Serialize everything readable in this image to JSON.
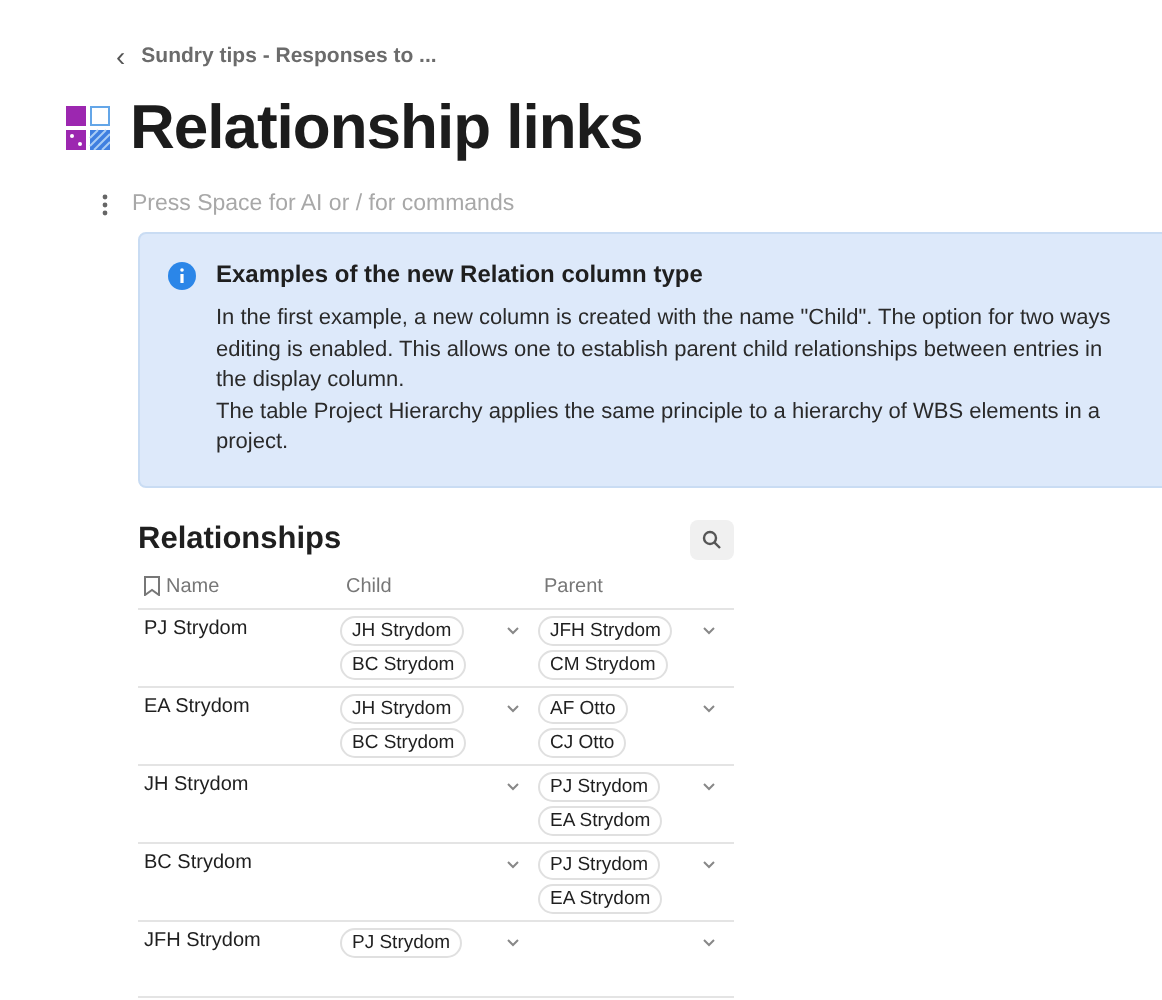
{
  "breadcrumb": {
    "back": "‹",
    "label": "Sundry tips - Responses to ..."
  },
  "page": {
    "title": "Relationship links",
    "placeholder": "Press Space for AI or / for commands"
  },
  "callout": {
    "title": "Examples of the new Relation column type",
    "paragraphs": [
      "In the first example, a new column is created with the name \"Child\". The option for two ways editing is enabled. This allows one to establish parent child relationships between entries in the display column.",
      "The table Project Hierarchy applies the same principle to a hierarchy of WBS elements in a project."
    ]
  },
  "table": {
    "title": "Relationships",
    "columns": [
      "Name",
      "Child",
      "Parent"
    ],
    "rows": [
      {
        "name": "PJ Strydom",
        "child": [
          "JH Strydom",
          "BC Strydom"
        ],
        "parent": [
          "JFH Strydom",
          "CM Strydom"
        ]
      },
      {
        "name": "EA Strydom",
        "child": [
          "JH Strydom",
          "BC Strydom"
        ],
        "parent": [
          "AF Otto",
          "CJ Otto"
        ]
      },
      {
        "name": "JH Strydom",
        "child": [],
        "parent": [
          "PJ Strydom",
          "EA Strydom"
        ]
      },
      {
        "name": "BC Strydom",
        "child": [],
        "parent": [
          "PJ Strydom",
          "EA Strydom"
        ]
      },
      {
        "name": "JFH Strydom",
        "child": [
          "PJ Strydom"
        ],
        "parent": []
      }
    ]
  }
}
